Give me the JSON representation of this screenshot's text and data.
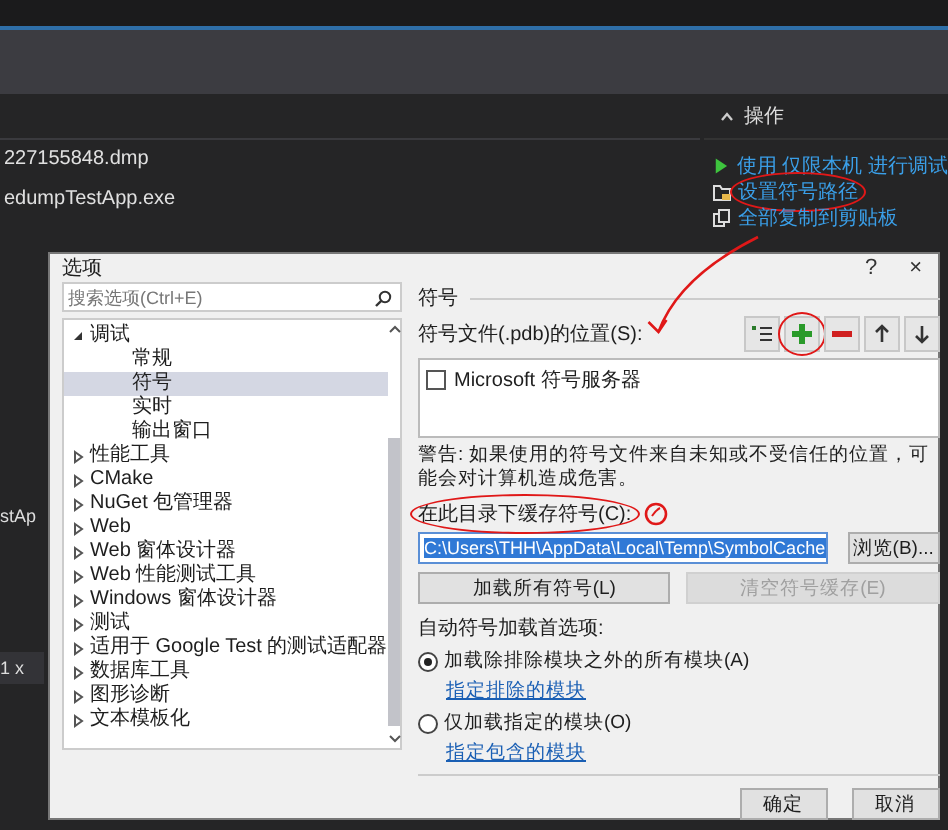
{
  "background": {
    "actions_panel": {
      "title": "操作",
      "links": [
        {
          "label": "使用 仅限本机 进行调试",
          "kind": "run"
        },
        {
          "label": "设置符号路径",
          "kind": "folder"
        },
        {
          "label": "全部复制到剪贴板",
          "kind": "copy"
        }
      ]
    },
    "files": [
      "227155848.dmp",
      "edumpTestApp.exe"
    ],
    "side_texts": [
      "stAp",
      "1 x"
    ]
  },
  "red_annotations": true,
  "dialog": {
    "title": "选项",
    "help": "?",
    "close": "×",
    "search": {
      "placeholder": "搜索选项(Ctrl+E)"
    },
    "tree": [
      {
        "label": "调试",
        "expanded": true,
        "selected": false,
        "children": [
          {
            "label": "常规",
            "selected": false
          },
          {
            "label": "符号",
            "selected": true
          },
          {
            "label": "实时",
            "selected": false
          },
          {
            "label": "输出窗口",
            "selected": false
          }
        ]
      },
      {
        "label": "性能工具",
        "expanded": false,
        "selected": false
      },
      {
        "label": "CMake",
        "expanded": false,
        "selected": false
      },
      {
        "label": "NuGet 包管理器",
        "expanded": false,
        "selected": false
      },
      {
        "label": "Web",
        "expanded": false,
        "selected": false
      },
      {
        "label": "Web 窗体设计器",
        "expanded": false,
        "selected": false
      },
      {
        "label": "Web 性能测试工具",
        "expanded": false,
        "selected": false
      },
      {
        "label": "Windows 窗体设计器",
        "expanded": false,
        "selected": false
      },
      {
        "label": "测试",
        "expanded": false,
        "selected": false
      },
      {
        "label": "适用于 Google Test 的测试适配器",
        "expanded": false,
        "selected": false
      },
      {
        "label": "数据库工具",
        "expanded": false,
        "selected": false
      },
      {
        "label": "图形诊断",
        "expanded": false,
        "selected": false
      },
      {
        "label": "文本模板化",
        "expanded": false,
        "selected": false
      }
    ],
    "page": {
      "heading": "符号",
      "locations_label": "符号文件(.pdb)的位置(S):",
      "toolbar": [
        {
          "kind": "import"
        },
        {
          "kind": "add"
        },
        {
          "kind": "remove"
        },
        {
          "kind": "up"
        },
        {
          "kind": "down"
        }
      ],
      "locations": [
        {
          "label": "Microsoft 符号服务器",
          "checked": false
        }
      ],
      "warning": "警告: 如果使用的符号文件来自未知或不受信任的位置，可能会对计算机造成危害。",
      "cache_label": "在此目录下缓存符号(C):",
      "cache_path": "C:\\Users\\THH\\AppData\\Local\\Temp\\SymbolCache",
      "browse": "浏览(B)...",
      "load_all": {
        "label": "加载所有符号(L)",
        "disabled": false
      },
      "clear_cache": {
        "label": "清空符号缓存(E)",
        "disabled": true
      },
      "auto_load_label": "自动符号加载首选项:",
      "options": [
        {
          "label": "加载除排除模块之外的所有模块(A)",
          "selected": true,
          "link": "指定排除的模块"
        },
        {
          "label": "仅加载指定的模块(O)",
          "selected": false,
          "link": "指定包含的模块"
        }
      ]
    },
    "buttons": [
      "确定",
      "取消"
    ]
  }
}
